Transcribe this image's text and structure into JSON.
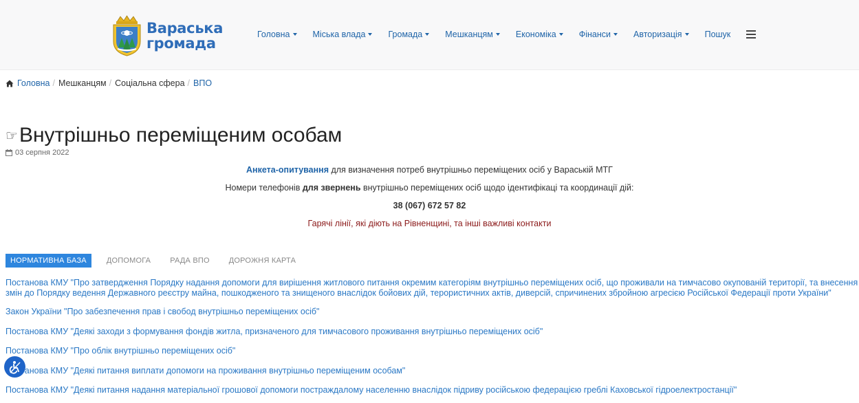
{
  "header": {
    "logo_text_line1": "Вараська",
    "logo_text_line2": "громада",
    "nav": [
      {
        "label": "Головна",
        "dropdown": true
      },
      {
        "label": "Міська влада",
        "dropdown": true
      },
      {
        "label": "Громада",
        "dropdown": true
      },
      {
        "label": "Мешканцям",
        "dropdown": true
      },
      {
        "label": "Економіка",
        "dropdown": true
      },
      {
        "label": "Фінанси",
        "dropdown": true
      },
      {
        "label": "Авторизація",
        "dropdown": true
      },
      {
        "label": "Пошук",
        "dropdown": false
      }
    ]
  },
  "breadcrumb": {
    "home": "Головна",
    "item2": "Мешканцям",
    "item3": "Соціальна сфера",
    "item4": "ВПО"
  },
  "article": {
    "icon": "☞",
    "title": "Внутрішньо переміщеним особам",
    "date": "03 серпня 2022",
    "line1_link": "Анкета-опитування",
    "line1_rest": " для визначення потреб внутрішньо переміщених осіб у Вараській МТГ",
    "line2_a": "Номери телефонів ",
    "line2_bold": "для звернень",
    "line2_b": " внутрішньо переміщених осіб щодо ідентифікаці та координації дій:",
    "phone": "38 (067) 672 57 82",
    "hotlines": "Гарячі лінії, які діють на Рівненщині, та інші важливі контакти"
  },
  "tabs": [
    {
      "label": "НОРМАТИВНА БАЗА",
      "active": true
    },
    {
      "label": "ДОПОМОГА",
      "active": false
    },
    {
      "label": "РАДА ВПО",
      "active": false
    },
    {
      "label": "ДОРОЖНЯ КАРТА",
      "active": false
    }
  ],
  "documents": [
    "Постанова КМУ \"Про затвердження Порядку надання допомоги для вирішення житлового питання окремим категоріям внутрішньо переміщених осіб, що проживали на тимчасово окупованій території, та внесення змін до Порядку ведення Державного реєстру майна, пошкодженого та знищеного внаслідок бойових дій, терористичних актів, диверсій, спричинених збройною агресією Російської Федерації проти України\"",
    "Закон України \"Про забезпечення прав і свобод внутрішньо переміщених осіб\"",
    "Постанова КМУ \"Деякі заходи з формування фондів житла, призначеного для тимчасового проживання внутрішньо переміщених осіб\"",
    "Постанова КМУ \"Про облік внутрішньо переміщених осіб\"",
    "Постанова КМУ \"Деякі питання виплати допомоги на проживання внутрішньо переміщеним особам\"",
    "Постанова КМУ \"Деякі питання надання матеріальної грошової допомоги постраждалому населенню внаслідок підриву російською федерацією греблі Каховської гідроелектростанції\""
  ],
  "colors": {
    "link": "#1f64a8",
    "doc_link": "#2a78c5",
    "active_tab": "#2e86de",
    "hotline": "#8b1a1a",
    "logo_text": "#2f6db8"
  }
}
